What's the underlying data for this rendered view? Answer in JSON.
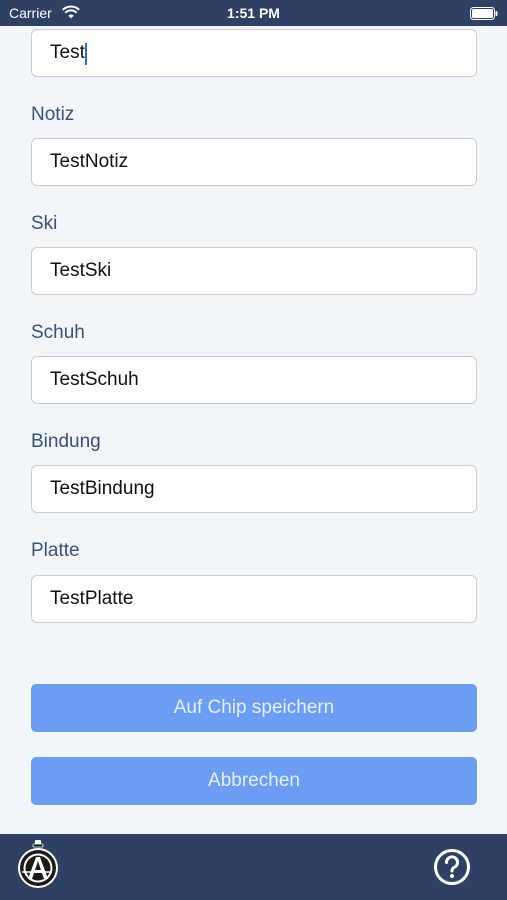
{
  "status_bar": {
    "carrier": "Carrier",
    "time": "1:51 PM",
    "icons": [
      "wifi-icon",
      "battery-icon"
    ]
  },
  "form": {
    "first_field_value": "Test",
    "notiz": {
      "label": "Notiz",
      "value": "TestNotiz"
    },
    "ski": {
      "label": "Ski",
      "value": "TestSki"
    },
    "schuh": {
      "label": "Schuh",
      "value": "TestSchuh"
    },
    "bindung": {
      "label": "Bindung",
      "value": "TestBindung"
    },
    "platte": {
      "label": "Platte",
      "value": "TestPlatte"
    }
  },
  "actions": {
    "save_label": "Auf Chip speichern",
    "cancel_label": "Abbrechen"
  },
  "tab_bar": {
    "icons": [
      "app-logo-icon",
      "help-icon"
    ]
  },
  "colors": {
    "bar": "#2e4164",
    "background": "#f2f5f9",
    "label": "#3b5178",
    "button": "#6b9ef2",
    "button_text": "#e6eefc"
  }
}
